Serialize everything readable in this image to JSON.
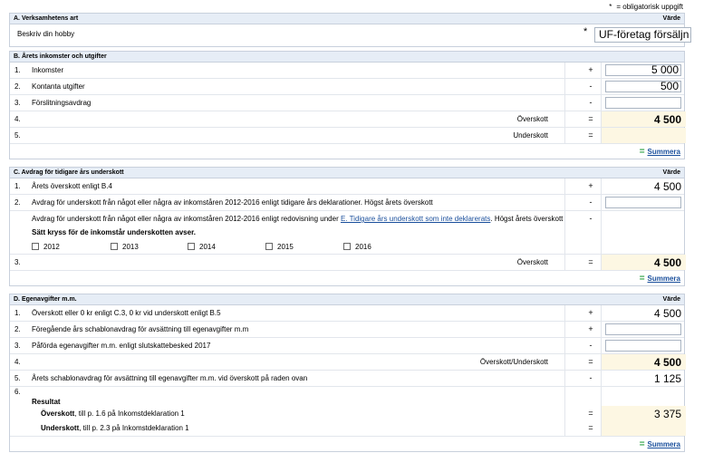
{
  "note": {
    "star": "*",
    "text": "= obligatorisk uppgift"
  },
  "secA": {
    "title": "A. Verksamhetens art",
    "value_header": "Värde",
    "rows": [
      {
        "label": "Beskriv din hobby",
        "star": "*",
        "value": "UF-företag försäljn"
      }
    ]
  },
  "secB": {
    "title": "B. Årets inkomster och utgifter",
    "value_header": "Värde",
    "rows": [
      {
        "num": "1.",
        "label": "Inkomster",
        "op": "+",
        "value": "5 000"
      },
      {
        "num": "2.",
        "label": "Kontanta utgifter",
        "op": "-",
        "value": "500"
      },
      {
        "num": "3.",
        "label": "Förslitningsavdrag",
        "op": "-",
        "value": ""
      },
      {
        "num": "4.",
        "rlabel": "Överskott",
        "op": "=",
        "value": "4 500"
      },
      {
        "num": "5.",
        "rlabel": "Underskott",
        "op": "=",
        "value": ""
      }
    ],
    "summera": "Summera"
  },
  "secC": {
    "title": "C. Avdrag för tidigare års underskott",
    "value_header": "Värde",
    "rows": [
      {
        "num": "1.",
        "label": "Årets överskott enligt B.4",
        "op": "+",
        "value": "4 500"
      },
      {
        "num": "2.",
        "label": "Avdrag för underskott från något eller några av inkomståren 2012-2016 enligt tidigare års deklarationer. Högst årets överskott",
        "op": "-",
        "value": ""
      },
      {
        "label_pre": "Avdrag för underskott från något eller några av inkomståren 2012-2016 enligt redovisning under ",
        "link": "E. Tidigare års underskott som inte deklarerats",
        "label_post": ". Högst årets överskott",
        "op": "-"
      },
      {
        "label": "Sätt kryss för de inkomstår underskotten avser."
      },
      {
        "num": "3.",
        "rlabel": "Överskott",
        "op": "=",
        "value": "4 500"
      }
    ],
    "years": [
      "2012",
      "2013",
      "2014",
      "2015",
      "2016"
    ],
    "summera": "Summera"
  },
  "secD": {
    "title": "D. Egenavgifter m.m.",
    "value_header": "Värde",
    "rows": [
      {
        "num": "1.",
        "label": "Överskott eller 0 kr enligt C.3, 0 kr vid underskott enligt B.5",
        "op": "+",
        "value": "4 500"
      },
      {
        "num": "2.",
        "label": "Föregående års schablonavdrag för avsättning till egenavgifter m.m",
        "op": "+",
        "value": ""
      },
      {
        "num": "3.",
        "label": "Påförda egenavgifter m.m. enligt slutskattebesked 2017",
        "op": "-",
        "value": ""
      },
      {
        "num": "4.",
        "rlabel": "Överskott/Underskott",
        "op": "=",
        "value": "4 500"
      },
      {
        "num": "5.",
        "label": "Årets schablonavdrag för avsättning till egenavgifter m.m. vid överskott på raden ovan",
        "op": "-",
        "value": "1 125"
      },
      {
        "num": "6.",
        "label": "Resultat"
      },
      {
        "label_bold": "Överskott",
        "label_rest": ", till p. 1.6 på Inkomstdeklaration 1",
        "op": "=",
        "value": "3 375"
      },
      {
        "label_bold": "Underskott",
        "label_rest": ", till p. 2.3 på Inkomstdeklaration 1",
        "op": "=",
        "value": ""
      }
    ],
    "summera": "Summera"
  },
  "colors": {
    "header_bg": "#e6edf6",
    "border": "#c8d0dc",
    "sum_bg": "#fdf7e3",
    "link": "#1a4f9c",
    "summera_icon": "#2aa040"
  }
}
